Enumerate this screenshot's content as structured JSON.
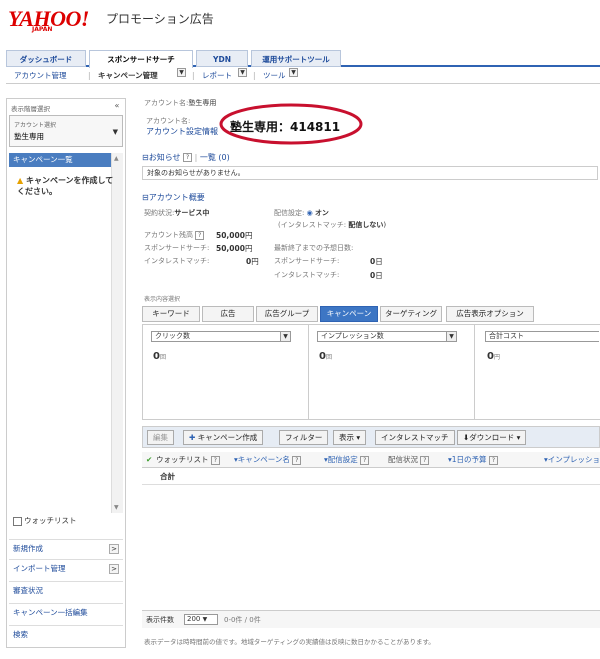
{
  "header": {
    "logo": "YAHOO!",
    "logo_sub": "JAPAN",
    "title": "プロモーション広告"
  },
  "tabs": [
    "ダッシュボード",
    "スポンサードサーチ",
    "YDN",
    "運用サポートツール"
  ],
  "subnav": {
    "account": "アカウント管理",
    "campaign": "キャンペーン管理",
    "report": "レポート",
    "tools": "ツール"
  },
  "sidebar": {
    "heading": "表示階層選択",
    "collapse": "«",
    "account_label": "アカウント選択",
    "account_value": "塾生専用",
    "campaign_list": "キャンペーン一覧",
    "warning": "キャンペーンを作成してください。",
    "watchlist": "ウォッチリスト",
    "menu": [
      {
        "label": "新規作成",
        "arrow": ">"
      },
      {
        "label": "インポート管理",
        "arrow": ">"
      },
      {
        "label": "審査状況"
      },
      {
        "label": "キャンペーン一括編集"
      },
      {
        "label": "検索"
      }
    ]
  },
  "main": {
    "account_caption": "アカウント名:",
    "account_caption_value": "塾生専用",
    "account_name_label": "アカウント名:",
    "account_settings_link": "アカウント設定情報",
    "account_big": "塾生専用：414811",
    "notice_title": "お知らせ",
    "notice_list": "一覧 (0)",
    "notice_text": "対象のお知らせがありません。",
    "overview_title": "アカウント概要",
    "contract_label": "契約状況:",
    "contract_value": "サービス中",
    "balance_label": "アカウント残高",
    "balance_value": "50,000",
    "balance_unit": "円",
    "ss_label": "スポンサードサーチ:",
    "ss_value": "50,000",
    "ss_unit": "円",
    "im_label": "インタレストマッチ:",
    "im_value": "0",
    "im_unit": "円",
    "delivery_label": "配信設定:",
    "delivery_on": "オン",
    "im_delivery_label": "(インタレストマッチ:",
    "im_delivery_value": "配信しない",
    "im_delivery_close": ")",
    "days_label": "最新終了までの予想日数:",
    "days_ss_label": "スポンサードサーチ:",
    "days_ss_value": "0",
    "days_ss_unit": "日",
    "days_im_label": "インタレストマッチ:",
    "days_im_value": "0",
    "days_im_unit": "日",
    "display_content": "表示内容選択",
    "content_tabs": [
      "キーワード",
      "広告",
      "広告グループ",
      "キャンペーン",
      "ターゲティング",
      "広告表示オプション"
    ],
    "metrics": [
      {
        "select": "クリック数",
        "value": "0",
        "unit": "回"
      },
      {
        "select": "インプレッション数",
        "value": "0",
        "unit": "回"
      },
      {
        "select": "合計コスト",
        "value": "0",
        "unit": "円"
      }
    ],
    "toolbar": [
      "編集",
      "キャンペーン作成",
      "フィルター",
      "表示",
      "インタレストマッチ",
      "ダウンロード"
    ],
    "columns": [
      "ウォッチリスト",
      "キャンペーン名",
      "配信設定",
      "配信状況",
      "1日の予算",
      "インプレッション"
    ],
    "total_row": "合計",
    "rows_label": "表示件数",
    "rows_value": "200",
    "count_text": "0-0件 / 0件",
    "footnote": "表示データは時時間前の値です。地域ターゲティングの実績値は反映に数日かかることがあります。"
  },
  "colors": {
    "accent": "#2f63b3",
    "active_tab": "#3d76c4",
    "logo": "#dd0000",
    "circle": "#c8102e"
  }
}
